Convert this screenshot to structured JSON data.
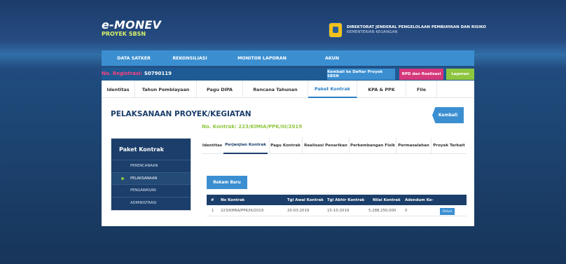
{
  "brand": {
    "logo": "e-MONEV",
    "subtitle": "PROYEK SBSN"
  },
  "ministry": {
    "line1": "DIREKTORAT JENDERAL PENGELOLAAN PEMBIAYAAN DAN RISIKO",
    "line2": "KEMENTERIAN KEUANGAN"
  },
  "topnav": {
    "items": [
      "DATA SATKER",
      "REKONSILIASI",
      "MONITOR LAPORAN",
      "AKUN"
    ]
  },
  "registrasi": {
    "label": "No. Registrasi",
    "value": "S0790119"
  },
  "actions": {
    "back_to_list": "Kembali ke Daftar Proyek SBSN",
    "rpd": "RPD dan Realisasi",
    "laporan": "Laporan"
  },
  "tabs": [
    "Identitas",
    "Tahun Pembiayaan",
    "Pagu DIPA",
    "Rencana Tahunan",
    "Paket Kontrak",
    "KPA & PPK",
    "File"
  ],
  "page": {
    "title": "PELAKSANAAN PROYEK/KEGIATAN",
    "kontrak_label": "No. Kontrak: 223/KIMIA/PPK/III/2019",
    "back": "Kembali"
  },
  "sidebar": {
    "title": "Paket Kontrak",
    "items": [
      "PERENCANAAN",
      "PELAKSANAAN",
      "PENGAWASAN",
      "ADMINISTRASI"
    ]
  },
  "subtabs": [
    "Identitas",
    "Perjanjian Kontrak",
    "Pagu Kontrak",
    "Realisasi Penarikan",
    "Perkembangan Fisik",
    "Permasalahan",
    "Proyek Terkait"
  ],
  "rekam_baru": "Rekam Baru",
  "table": {
    "headers": [
      "#",
      "No Kontrak",
      "Tgl Awal Kontrak",
      "Tgl Akhir Kontrak",
      "Nilai Kontrak",
      "Adendum Ke-"
    ],
    "rows": [
      [
        "1",
        "223/KIMIA/PPK/III/2019",
        "20-03-2019",
        "15-10-2019",
        "5,288,250,000",
        "0"
      ]
    ],
    "detail_label": "Detail"
  },
  "colors": {
    "accent": "#3b8fd1",
    "navy": "#1b3e6a",
    "green": "#8ec63f",
    "pink": "#d6387c"
  }
}
